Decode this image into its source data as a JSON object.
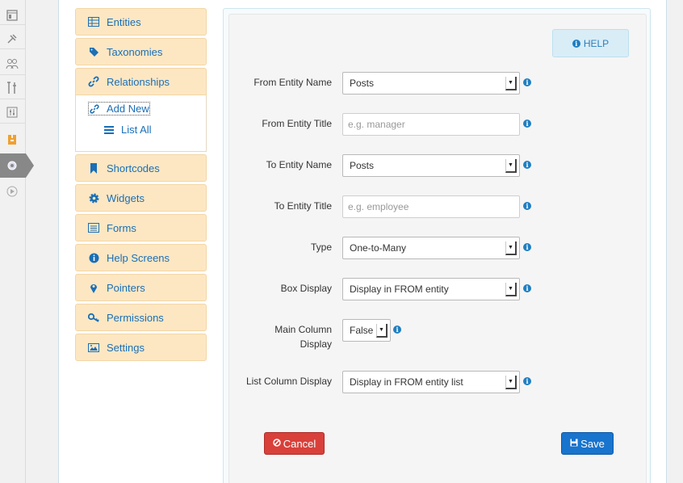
{
  "menu": {
    "items": [
      {
        "label": "Entities",
        "icon": "table-icon"
      },
      {
        "label": "Taxonomies",
        "icon": "tag-icon"
      },
      {
        "label": "Relationships",
        "icon": "link-icon"
      },
      {
        "label": "Shortcodes",
        "icon": "bookmark-icon"
      },
      {
        "label": "Widgets",
        "icon": "gear-icon"
      },
      {
        "label": "Forms",
        "icon": "list-table-icon"
      },
      {
        "label": "Help Screens",
        "icon": "info-icon"
      },
      {
        "label": "Pointers",
        "icon": "map-marker-icon"
      },
      {
        "label": "Permissions",
        "icon": "key-icon"
      },
      {
        "label": "Settings",
        "icon": "picture-icon"
      }
    ],
    "sub": {
      "add_new": "Add New",
      "list_all": "List All"
    }
  },
  "help": {
    "label": "HELP"
  },
  "form": {
    "from_entity_name": {
      "label": "From Entity Name",
      "value": "Posts"
    },
    "from_entity_title": {
      "label": "From Entity Title",
      "placeholder": "e.g. manager"
    },
    "to_entity_name": {
      "label": "To Entity Name",
      "value": "Posts"
    },
    "to_entity_title": {
      "label": "To Entity Title",
      "placeholder": "e.g. employee"
    },
    "type": {
      "label": "Type",
      "value": "One-to-Many"
    },
    "box_display": {
      "label": "Box Display",
      "value": "Display in FROM entity"
    },
    "main_column_display": {
      "label_line1": "Main Column",
      "label_line2": "Display",
      "value": "False"
    },
    "list_column_display": {
      "label": "List Column Display",
      "value": "Display in FROM entity list"
    }
  },
  "buttons": {
    "cancel": "Cancel",
    "save": "Save"
  },
  "colors": {
    "menu_bg": "#fde7c3",
    "link": "#1a6fb7",
    "cancel": "#d9403a",
    "save": "#1874cd",
    "help_bg": "#d9edf7"
  }
}
